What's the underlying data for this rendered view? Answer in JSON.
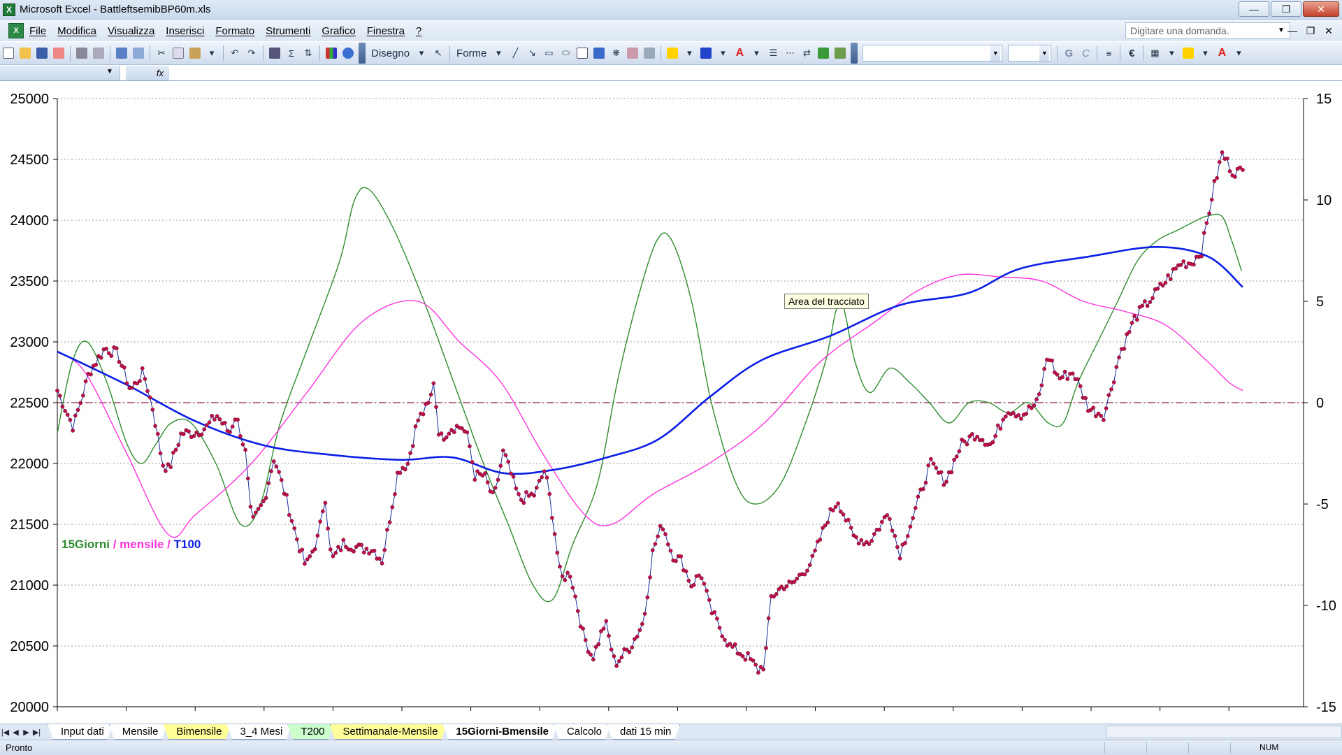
{
  "window": {
    "title": "Microsoft Excel - BattleftsemibBP60m.xls",
    "app_icon": "excel-icon"
  },
  "menu": {
    "items": [
      "File",
      "Modifica",
      "Visualizza",
      "Inserisci",
      "Formato",
      "Strumenti",
      "Grafico",
      "Finestra",
      "?"
    ],
    "ask_placeholder": "Digitare una domanda."
  },
  "toolbar": {
    "drawing_label": "Disegno",
    "shapes_label": "Forme",
    "bold_label": "G",
    "italic_label": "C",
    "euro_label": "€"
  },
  "formula_bar": {
    "fx_label": "fx"
  },
  "chart_data": {
    "type": "line",
    "y_left_ticks": [
      "25000",
      "24500",
      "24000",
      "23500",
      "23000",
      "22500",
      "22000",
      "21500",
      "21000",
      "20500",
      "20000"
    ],
    "y_right_ticks": [
      "15",
      "10",
      "5",
      "0",
      "-5",
      "-10",
      "-15"
    ],
    "ylim_left": [
      20000,
      25000
    ],
    "ylim_right": [
      -15,
      15
    ],
    "grid": "horizontal dotted",
    "legend": {
      "green": "15Giorni",
      "sep1": " / ",
      "magenta": "mensile",
      "sep2": " / ",
      "blue": "T100"
    },
    "tooltip": "Area del tracciato",
    "colors": {
      "price": "#1a2a9a",
      "marker": "#c0104a",
      "green": "#2e8b2e",
      "magenta": "#ff33dd",
      "blue": "#0a1ee6",
      "zero_line": "#8b2252"
    },
    "n_points": 461,
    "price_anchors": [
      [
        0,
        22600
      ],
      [
        10,
        22300
      ],
      [
        20,
        22750
      ],
      [
        30,
        22950
      ],
      [
        38,
        22900
      ],
      [
        46,
        22600
      ],
      [
        54,
        22750
      ],
      [
        60,
        22450
      ],
      [
        66,
        22000
      ],
      [
        70,
        21950
      ],
      [
        78,
        22250
      ],
      [
        86,
        22250
      ],
      [
        94,
        22300
      ],
      [
        100,
        22400
      ],
      [
        108,
        22250
      ],
      [
        112,
        22400
      ],
      [
        118,
        22100
      ],
      [
        122,
        21500
      ],
      [
        130,
        21700
      ],
      [
        136,
        22050
      ],
      [
        144,
        21700
      ],
      [
        150,
        21400
      ],
      [
        156,
        21150
      ],
      [
        164,
        21400
      ],
      [
        168,
        21750
      ],
      [
        172,
        21200
      ],
      [
        180,
        21350
      ],
      [
        190,
        21300
      ],
      [
        198,
        21300
      ],
      [
        204,
        21200
      ],
      [
        210,
        21650
      ],
      [
        214,
        21950
      ],
      [
        220,
        22000
      ],
      [
        226,
        22350
      ],
      [
        234,
        22500
      ],
      [
        236,
        22700
      ],
      [
        240,
        22200
      ],
      [
        248,
        22300
      ],
      [
        254,
        22300
      ],
      [
        258,
        22200
      ],
      [
        262,
        21900
      ],
      [
        268,
        21900
      ],
      [
        274,
        21700
      ],
      [
        280,
        22100
      ],
      [
        290,
        21700
      ],
      [
        300,
        21750
      ],
      [
        306,
        21950
      ],
      [
        310,
        21650
      ],
      [
        316,
        21050
      ],
      [
        322,
        21100
      ],
      [
        330,
        20600
      ],
      [
        336,
        20400
      ],
      [
        344,
        20700
      ],
      [
        350,
        20350
      ],
      [
        360,
        20500
      ],
      [
        368,
        20700
      ],
      [
        374,
        21300
      ],
      [
        380,
        21500
      ],
      [
        386,
        21250
      ],
      [
        392,
        21200
      ],
      [
        398,
        21000
      ],
      [
        404,
        21100
      ],
      [
        410,
        20800
      ],
      [
        416,
        20650
      ],
      [
        422,
        20500
      ],
      [
        428,
        20450
      ],
      [
        434,
        20400
      ],
      [
        440,
        20300
      ],
      [
        444,
        20350
      ],
      [
        448,
        20900
      ],
      [
        456,
        21000
      ],
      [
        461,
        21000
      ]
    ],
    "price_tail": [
      [
        0,
        21000
      ],
      [
        8,
        21200
      ],
      [
        14,
        21550
      ],
      [
        18,
        21700
      ],
      [
        24,
        21400
      ],
      [
        30,
        21350
      ],
      [
        38,
        21600
      ],
      [
        42,
        21250
      ],
      [
        48,
        21600
      ],
      [
        54,
        22000
      ],
      [
        60,
        21850
      ],
      [
        66,
        22150
      ],
      [
        72,
        22250
      ],
      [
        78,
        22150
      ],
      [
        84,
        22450
      ],
      [
        90,
        22400
      ],
      [
        96,
        22500
      ],
      [
        100,
        22900
      ],
      [
        104,
        22700
      ],
      [
        110,
        22750
      ],
      [
        116,
        22450
      ],
      [
        122,
        22400
      ],
      [
        128,
        22900
      ],
      [
        134,
        23200
      ],
      [
        140,
        23350
      ],
      [
        146,
        23500
      ],
      [
        152,
        23650
      ],
      [
        156,
        23650
      ],
      [
        160,
        23750
      ],
      [
        164,
        24200
      ],
      [
        168,
        24550
      ],
      [
        172,
        24400
      ],
      [
        176,
        24400
      ]
    ],
    "t100_anchors": [
      [
        0,
        22920
      ],
      [
        40,
        22650
      ],
      [
        80,
        22350
      ],
      [
        120,
        22150
      ],
      [
        160,
        22070
      ],
      [
        200,
        22030
      ],
      [
        230,
        22050
      ],
      [
        260,
        21920
      ],
      [
        290,
        21950
      ],
      [
        320,
        22050
      ],
      [
        350,
        22200
      ],
      [
        380,
        22550
      ],
      [
        410,
        22850
      ],
      [
        450,
        23050
      ],
      [
        490,
        23300
      ],
      [
        530,
        23400
      ],
      [
        560,
        23600
      ],
      [
        600,
        23700
      ],
      [
        640,
        23780
      ],
      [
        670,
        23700
      ],
      [
        690,
        23450
      ]
    ],
    "mensile_anchors": [
      [
        0,
        2.5
      ],
      [
        20,
        1.5
      ],
      [
        50,
        -2.5
      ],
      [
        80,
        -6.5
      ],
      [
        100,
        -5.5
      ],
      [
        140,
        -3
      ],
      [
        180,
        0.5
      ],
      [
        220,
        4
      ],
      [
        260,
        5
      ],
      [
        290,
        3
      ],
      [
        320,
        1
      ],
      [
        350,
        -2.5
      ],
      [
        380,
        -5.5
      ],
      [
        400,
        -6
      ],
      [
        430,
        -4.5
      ],
      [
        470,
        -3
      ],
      [
        510,
        -1
      ],
      [
        550,
        2
      ],
      [
        590,
        4
      ],
      [
        620,
        5.5
      ],
      [
        650,
        6.3
      ],
      [
        680,
        6.2
      ],
      [
        710,
        6.0
      ],
      [
        740,
        5.0
      ],
      [
        770,
        4.5
      ],
      [
        800,
        3.8
      ],
      [
        830,
        2.0
      ],
      [
        845,
        1.0
      ],
      [
        855,
        0.6
      ]
    ],
    "green_anchors": [
      [
        0,
        -1.5
      ],
      [
        15,
        2
      ],
      [
        30,
        3
      ],
      [
        50,
        1
      ],
      [
        70,
        -2
      ],
      [
        85,
        -3
      ],
      [
        100,
        -2
      ],
      [
        115,
        -1
      ],
      [
        135,
        -1
      ],
      [
        160,
        -3
      ],
      [
        185,
        -6
      ],
      [
        205,
        -5
      ],
      [
        225,
        -1
      ],
      [
        255,
        3
      ],
      [
        285,
        7
      ],
      [
        300,
        10
      ],
      [
        315,
        10.5
      ],
      [
        340,
        8.5
      ],
      [
        370,
        5
      ],
      [
        400,
        1
      ],
      [
        430,
        -3
      ],
      [
        455,
        -6
      ],
      [
        480,
        -9
      ],
      [
        500,
        -9.7
      ],
      [
        520,
        -7
      ],
      [
        545,
        -4
      ],
      [
        565,
        1
      ],
      [
        585,
        5
      ],
      [
        605,
        8
      ],
      [
        620,
        8
      ],
      [
        640,
        5
      ],
      [
        660,
        0
      ],
      [
        685,
        -4
      ],
      [
        705,
        -5
      ],
      [
        730,
        -4
      ],
      [
        755,
        -1
      ],
      [
        775,
        2
      ],
      [
        790,
        5
      ],
      [
        805,
        2
      ],
      [
        820,
        0.5
      ],
      [
        840,
        1.7
      ],
      [
        860,
        1
      ],
      [
        880,
        0
      ],
      [
        900,
        -1
      ],
      [
        920,
        0
      ],
      [
        940,
        0
      ],
      [
        960,
        -0.5
      ],
      [
        980,
        0
      ],
      [
        1000,
        -1
      ],
      [
        1015,
        -1
      ],
      [
        1030,
        1
      ],
      [
        1050,
        3
      ],
      [
        1070,
        5
      ],
      [
        1090,
        7
      ],
      [
        1110,
        8
      ],
      [
        1130,
        8.5
      ],
      [
        1150,
        9
      ],
      [
        1160,
        9.2
      ],
      [
        1175,
        9.2
      ],
      [
        1185,
        8
      ],
      [
        1195,
        6.5
      ]
    ]
  },
  "sheet_tabs": [
    "Input dati",
    "Mensile",
    "Bimensile",
    "3_4 Mesi",
    "T200",
    "Settimanale-Mensile",
    "15Giorni-Bmensile",
    "Calcolo",
    "dati 15 min"
  ],
  "active_tab": "15Giorni-Bmensile",
  "status": {
    "left": "Pronto",
    "num": "NUM"
  }
}
